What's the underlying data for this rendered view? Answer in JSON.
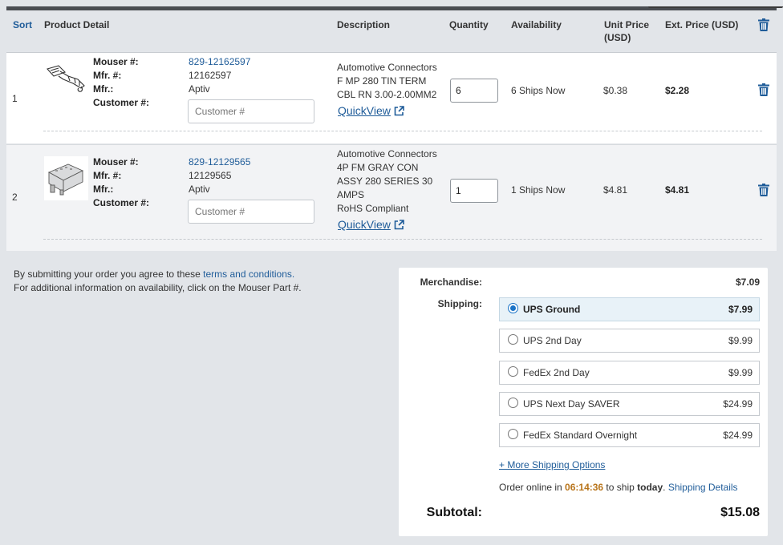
{
  "header": {
    "sort": "Sort",
    "product_detail": "Product Detail",
    "description": "Description",
    "quantity": "Quantity",
    "availability": "Availability",
    "unit_price": "Unit Price",
    "unit_price_currency": "(USD)",
    "ext_price": "Ext. Price (USD)",
    "delete_all_icon": "trash-icon"
  },
  "labels": {
    "mouser": "Mouser #:",
    "mfr_num": "Mfr. #:",
    "mfr": "Mfr.:",
    "customer": "Customer #:",
    "quickview": "QuickView",
    "customer_placeholder": "Customer #"
  },
  "rows": [
    {
      "index": "1",
      "mouser_num": "829-12162597",
      "mfr_num": "12162597",
      "mfr": "Aptiv",
      "desc_lines": [
        "Automotive Connectors",
        "F MP 280 TIN TERM",
        "CBL RN 3.00-2.00MM2"
      ],
      "quantity": "6",
      "availability": "6  Ships Now",
      "unit_price": "$0.38",
      "ext_price": "$2.28"
    },
    {
      "index": "2",
      "mouser_num": "829-12129565",
      "mfr_num": "12129565",
      "mfr": "Aptiv",
      "desc_lines": [
        "Automotive Connectors",
        "4P FM GRAY CON",
        "ASSY 280 SERIES 30",
        "AMPS",
        "RoHS Compliant"
      ],
      "quantity": "1",
      "availability": "1  Ships Now",
      "unit_price": "$4.81",
      "ext_price": "$4.81"
    }
  ],
  "terms": {
    "line1_prefix": "By submitting your order you agree to these ",
    "line1_link": "terms and conditions.",
    "line2": "For additional information on availability, click on the Mouser Part #."
  },
  "summary": {
    "merchandise_label": "Merchandise:",
    "merchandise_value": "$7.09",
    "shipping_label": "Shipping:",
    "options": [
      {
        "name": "UPS Ground",
        "price": "$7.99",
        "selected": true
      },
      {
        "name": "UPS 2nd Day",
        "price": "$9.99",
        "selected": false
      },
      {
        "name": "FedEx 2nd Day",
        "price": "$9.99",
        "selected": false
      },
      {
        "name": "UPS Next Day SAVER",
        "price": "$24.99",
        "selected": false
      },
      {
        "name": "FedEx Standard Overnight",
        "price": "$24.99",
        "selected": false
      }
    ],
    "more_options": "+ More Shipping Options",
    "order_prefix": "Order online in ",
    "timer": "06:14:36",
    "order_mid": " to ship ",
    "order_today": "today",
    "order_dot": ". ",
    "shipping_details": "Shipping Details",
    "subtotal_label": "Subtotal:",
    "subtotal_value": "$15.08"
  },
  "colors": {
    "link": "#1f5c99",
    "timer": "#b8741a",
    "selected_bg": "#e8f2f8",
    "page_bg": "#e2e5e9"
  }
}
